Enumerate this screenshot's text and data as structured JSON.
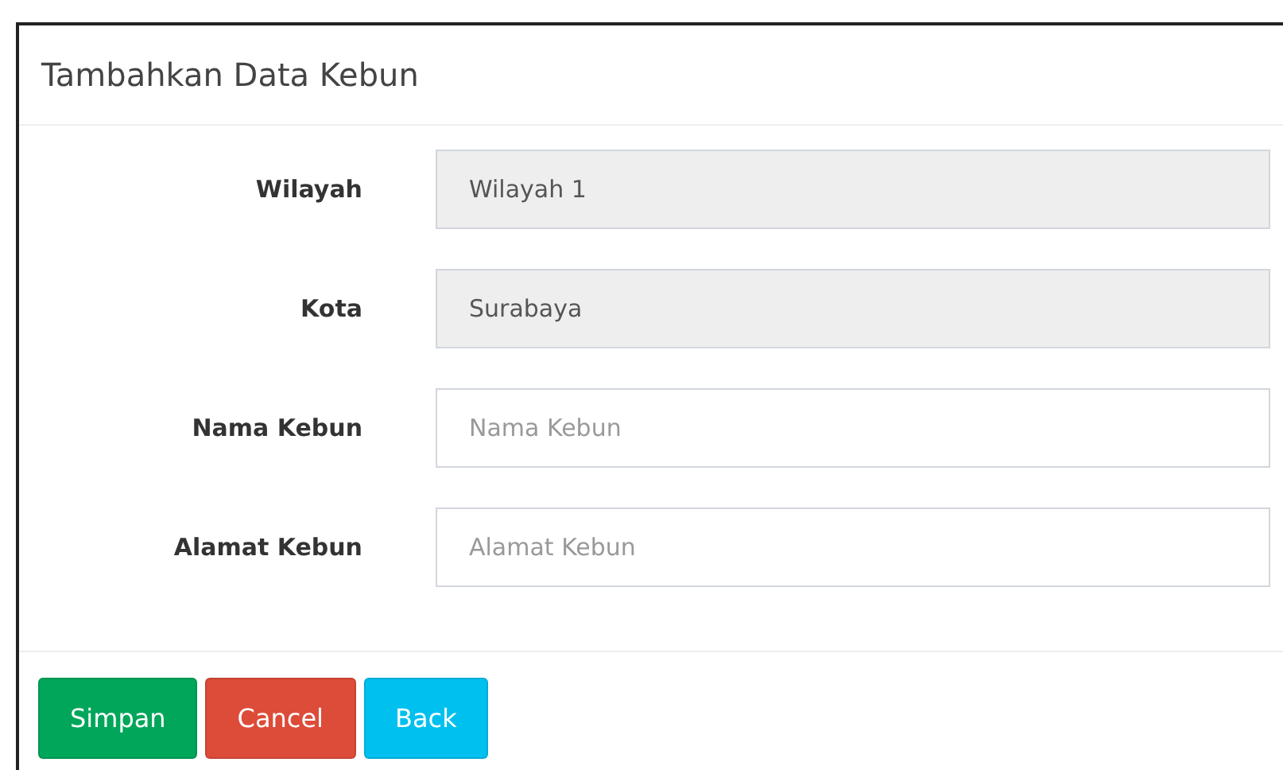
{
  "panel": {
    "title": "Tambahkan Data Kebun"
  },
  "fields": [
    {
      "label": "Wilayah",
      "value": "Wilayah 1",
      "disabled": true
    },
    {
      "label": "Kota",
      "value": "Surabaya",
      "disabled": true
    },
    {
      "label": "Nama Kebun",
      "placeholder": "Nama Kebun",
      "disabled": false
    },
    {
      "label": "Alamat Kebun",
      "placeholder": "Alamat Kebun",
      "disabled": false
    }
  ],
  "buttons": [
    {
      "label": "Simpan",
      "kind": "success"
    },
    {
      "label": "Cancel",
      "kind": "danger"
    },
    {
      "label": "Back",
      "kind": "info"
    }
  ]
}
